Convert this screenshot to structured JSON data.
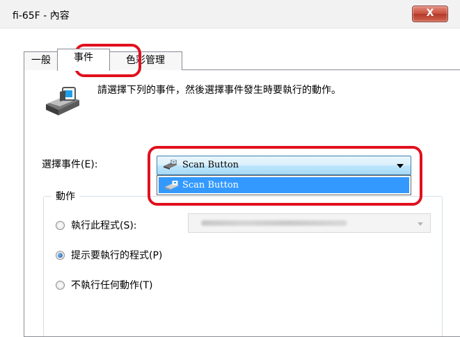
{
  "window": {
    "title": "fi-65F - 內容",
    "close_label": "X"
  },
  "tabs": [
    {
      "label": "一般",
      "active": false
    },
    {
      "label": "事件",
      "active": true
    },
    {
      "label": "色彩管理",
      "active": false
    }
  ],
  "event_tab": {
    "icon": "scanner-icon",
    "description": "請選擇下列的事件，然後選擇事件發生時要執行的動作。",
    "select_event_label": "選擇事件(E):",
    "selected_event": "Scan Button",
    "dropdown_options": [
      "Scan Button"
    ],
    "actions_group": {
      "title": "動作",
      "options": [
        {
          "label": "執行此程式(S):",
          "checked": false
        },
        {
          "label": "提示要執行的程式(P)",
          "checked": true
        },
        {
          "label": "不執行任何動作(T)",
          "checked": false
        }
      ]
    }
  },
  "colors": {
    "highlight": "#e0101e",
    "selection": "#3399ff"
  }
}
